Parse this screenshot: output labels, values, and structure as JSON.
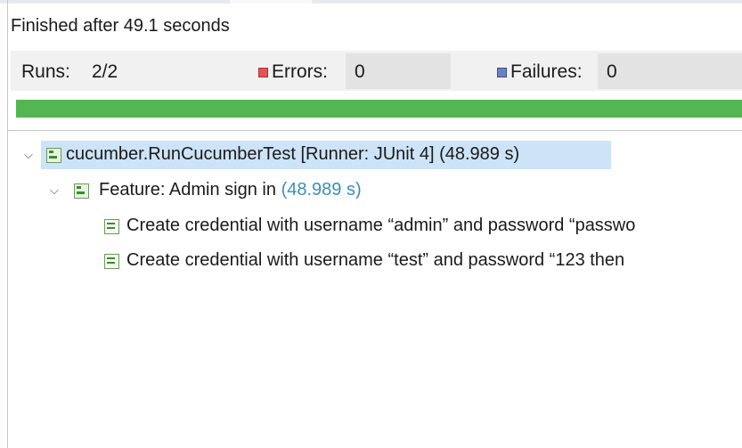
{
  "status_text": "Finished after 49.1 seconds",
  "stats": {
    "runs_label": "Runs:",
    "runs_value": "2/2",
    "errors_label": "Errors:",
    "errors_value": "0",
    "failures_label": "Failures:",
    "failures_value": "0"
  },
  "progress": {
    "fraction": 1.0,
    "color": "#54b553"
  },
  "tree": {
    "root": {
      "label": "cucumber.RunCucumberTest [Runner: JUnit 4] (48.989 s)",
      "icon": "test-suite-icon"
    },
    "feature": {
      "label": "Feature: Admin sign in",
      "time": "(48.989 s)",
      "icon": "test-suite-icon"
    },
    "tests": [
      {
        "label": "Create credential with username “admin” and password “passwo",
        "icon": "test-case-icon"
      },
      {
        "label": "Create credential with username “test” and password “123 then",
        "icon": "test-case-icon"
      }
    ]
  },
  "colors": {
    "selection": "#cde3f7",
    "time": "#3c8ec0",
    "error": "#e05555",
    "failure": "#6b83c4"
  }
}
